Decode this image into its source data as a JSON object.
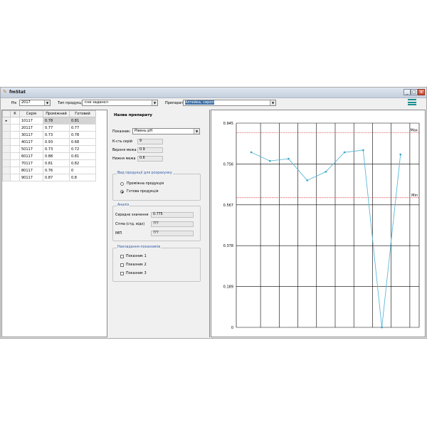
{
  "window": {
    "title": "fmStat",
    "minimize": "_",
    "maximize": "□",
    "close": "x"
  },
  "toolbar": {
    "year_label": "Рік",
    "year_value": "2017",
    "type_label": "Тип продукції",
    "type_value": "<не задано>",
    "drug_label": "Препарат",
    "drug_value": "Алтейка, сироп"
  },
  "grid": {
    "columns": [
      "К",
      "Серія",
      "Проміжний",
      "Готовий"
    ],
    "rows": [
      {
        "series": "10117",
        "intermediate": "0.78",
        "finished": "0.81"
      },
      {
        "series": "20117",
        "intermediate": "0.77",
        "finished": "0.77"
      },
      {
        "series": "30117",
        "intermediate": "0.73",
        "finished": "0.78"
      },
      {
        "series": "40117",
        "intermediate": "0.93",
        "finished": "0.68"
      },
      {
        "series": "50117",
        "intermediate": "0.73",
        "finished": "0.72"
      },
      {
        "series": "60117",
        "intermediate": "0.88",
        "finished": "0.81"
      },
      {
        "series": "70117",
        "intermediate": "0.81",
        "finished": "0.82"
      },
      {
        "series": "80117",
        "intermediate": "0.76",
        "finished": "0"
      },
      {
        "series": "90117",
        "intermediate": "0.87",
        "finished": "0.8"
      }
    ]
  },
  "details": {
    "title": "Назва препарату",
    "indicator_label": "Показник:",
    "indicator_value": "Рівень pH",
    "series_count_label": "К-сть серій",
    "series_count_value": "9",
    "upper_label": "Верхня межа",
    "upper_value": "0.9",
    "lower_label": "Нижня межа",
    "lower_value": "0.6",
    "product_group": {
      "title": "Вид продукції для розрахунку",
      "option_intermediate": "Проміжна продукція",
      "option_finished": "Готова продукція",
      "selected": "finished"
    },
    "analysis_group": {
      "title": "Аналіз",
      "mean_label": "Середнє значення",
      "mean_value": "0.775",
      "sigma_label": "Сігма (стд. відх)",
      "sigma_value": "???",
      "ip_label": "ІМП",
      "ip_value": "???"
    },
    "overlay_group": {
      "title": "Накладання показників",
      "item1": "Показник 1",
      "item2": "Показник 2",
      "item3": "Показник 3"
    }
  },
  "chart_data": {
    "type": "line",
    "x": [
      1,
      2,
      3,
      4,
      5,
      6,
      7,
      8,
      9
    ],
    "series": [
      {
        "values": [
          0.81,
          0.77,
          0.78,
          0.68,
          0.72,
          0.81,
          0.82,
          0,
          0.8
        ]
      }
    ],
    "yticks": [
      "0.945",
      "0.756",
      "0.567",
      "0.378",
      "0.189",
      "0"
    ],
    "ylim": [
      0,
      0.945
    ],
    "max_line": {
      "label": "Max",
      "value": 0.9
    },
    "min_line": {
      "label": "Min",
      "value": 0.6
    },
    "grid": true,
    "colors": {
      "line": "#5bb8d8",
      "limits": "#d04040"
    }
  }
}
